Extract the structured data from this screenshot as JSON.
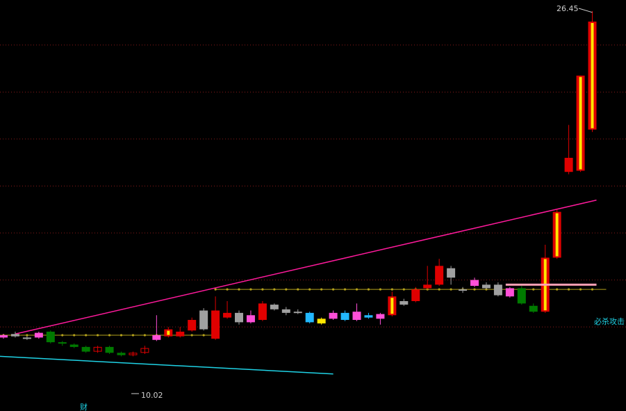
{
  "chart_data": {
    "type": "candlestick",
    "ylim": [
      9.6,
      26.8
    ],
    "grid": true,
    "colors": {
      "background": "#000000",
      "grid": "#8b1a1a",
      "up": "#e00000",
      "down": "#007a00",
      "trend_line": "#ff1a9c",
      "support_line": "#b5a21c",
      "lower_line": "#1fd3e6",
      "signal_line": "#ff9fb5",
      "signal_text": "#1fd3e6",
      "annotation": "#d0d0d0",
      "limit_up_fill": "#ffe600",
      "limit_up_edge": "#e00000"
    },
    "candles": [
      {
        "o": 12.65,
        "c": 12.55,
        "h": 12.7,
        "l": 12.5,
        "color": "#ff4fd8"
      },
      {
        "o": 12.7,
        "c": 12.6,
        "h": 12.8,
        "l": 12.55,
        "color": "#a0a0a0"
      },
      {
        "o": 12.55,
        "c": 12.5,
        "h": 12.6,
        "l": 12.45,
        "color": "#a0a0a0"
      },
      {
        "o": 12.75,
        "c": 12.55,
        "h": 12.8,
        "l": 12.5,
        "color": "#ff4fd8"
      },
      {
        "o": 12.8,
        "c": 12.35,
        "h": 12.85,
        "l": 12.3,
        "color": "#007a00"
      },
      {
        "o": 12.35,
        "c": 12.3,
        "h": 12.4,
        "l": 12.2,
        "color": "#007a00"
      },
      {
        "o": 12.25,
        "c": 12.15,
        "h": 12.3,
        "l": 12.1,
        "color": "#007a00"
      },
      {
        "o": 12.15,
        "c": 11.95,
        "h": 12.2,
        "l": 11.9,
        "color": "#007a00"
      },
      {
        "o": 11.95,
        "c": 12.15,
        "h": 12.2,
        "l": 11.9,
        "color": "#e00000",
        "hollow": true
      },
      {
        "o": 12.15,
        "c": 11.9,
        "h": 12.2,
        "l": 11.85,
        "color": "#007a00"
      },
      {
        "o": 11.9,
        "c": 11.8,
        "h": 11.95,
        "l": 11.75,
        "color": "#007a00"
      },
      {
        "o": 11.8,
        "c": 11.9,
        "h": 11.95,
        "l": 11.75,
        "color": "#e00000",
        "hollow": true
      },
      {
        "o": 11.9,
        "c": 12.1,
        "h": 12.2,
        "l": 11.85,
        "color": "#e00000",
        "hollow": true
      },
      {
        "o": 12.45,
        "c": 12.65,
        "h": 13.5,
        "l": 12.4,
        "color": "#ff4fd8"
      },
      {
        "o": 12.6,
        "c": 12.9,
        "h": 13.0,
        "l": 12.55,
        "color": "#e00000",
        "limit": true
      },
      {
        "o": 12.6,
        "c": 12.8,
        "h": 13.0,
        "l": 12.55,
        "color": "#e00000"
      },
      {
        "o": 12.85,
        "c": 13.3,
        "h": 13.4,
        "l": 12.8,
        "color": "#e00000"
      },
      {
        "o": 12.9,
        "c": 13.7,
        "h": 13.8,
        "l": 12.85,
        "color": "#a0a0a0"
      },
      {
        "o": 12.5,
        "c": 13.7,
        "h": 14.3,
        "l": 12.45,
        "color": "#e00000"
      },
      {
        "o": 13.4,
        "c": 13.6,
        "h": 14.1,
        "l": 13.35,
        "color": "#e00000"
      },
      {
        "o": 13.6,
        "c": 13.2,
        "h": 13.7,
        "l": 13.1,
        "color": "#a0a0a0"
      },
      {
        "o": 13.2,
        "c": 13.5,
        "h": 13.7,
        "l": 13.15,
        "color": "#ff4fd8"
      },
      {
        "o": 13.3,
        "c": 14.0,
        "h": 14.1,
        "l": 13.25,
        "color": "#e00000"
      },
      {
        "o": 13.95,
        "c": 13.75,
        "h": 14.0,
        "l": 13.7,
        "color": "#a0a0a0"
      },
      {
        "o": 13.75,
        "c": 13.6,
        "h": 13.85,
        "l": 13.5,
        "color": "#a0a0a0"
      },
      {
        "o": 13.65,
        "c": 13.6,
        "h": 13.75,
        "l": 13.55,
        "color": "#a0a0a0"
      },
      {
        "o": 13.6,
        "c": 13.2,
        "h": 13.65,
        "l": 13.15,
        "color": "#22b8ff"
      },
      {
        "o": 13.35,
        "c": 13.15,
        "h": 13.4,
        "l": 13.1,
        "color": "#ffe600"
      },
      {
        "o": 13.35,
        "c": 13.6,
        "h": 13.7,
        "l": 13.3,
        "color": "#ff4fd8"
      },
      {
        "o": 13.3,
        "c": 13.6,
        "h": 13.7,
        "l": 13.25,
        "color": "#22b8ff"
      },
      {
        "o": 13.3,
        "c": 13.65,
        "h": 14.0,
        "l": 13.25,
        "color": "#ff4fd8"
      },
      {
        "o": 13.5,
        "c": 13.4,
        "h": 13.6,
        "l": 13.35,
        "color": "#22b8ff"
      },
      {
        "o": 13.35,
        "c": 13.55,
        "h": 13.6,
        "l": 13.1,
        "color": "#ff4fd8"
      },
      {
        "o": 13.5,
        "c": 14.3,
        "h": 14.5,
        "l": 13.45,
        "color": "#e00000",
        "limit": true
      },
      {
        "o": 14.1,
        "c": 13.95,
        "h": 14.2,
        "l": 13.9,
        "color": "#a0a0a0"
      },
      {
        "o": 14.1,
        "c": 14.6,
        "h": 14.7,
        "l": 14.05,
        "color": "#e00000"
      },
      {
        "o": 14.65,
        "c": 14.8,
        "h": 15.6,
        "l": 14.6,
        "color": "#e00000"
      },
      {
        "o": 14.8,
        "c": 15.6,
        "h": 15.9,
        "l": 14.75,
        "color": "#e00000"
      },
      {
        "o": 15.5,
        "c": 15.1,
        "h": 15.6,
        "l": 14.8,
        "color": "#a0a0a0"
      },
      {
        "o": 14.55,
        "c": 14.6,
        "h": 14.7,
        "l": 14.45,
        "color": "#a0a0a0"
      },
      {
        "o": 15.0,
        "c": 14.75,
        "h": 15.1,
        "l": 14.7,
        "color": "#ff4fd8"
      },
      {
        "o": 14.8,
        "c": 14.65,
        "h": 14.9,
        "l": 14.6,
        "color": "#a0a0a0"
      },
      {
        "o": 14.8,
        "c": 14.35,
        "h": 14.9,
        "l": 14.3,
        "color": "#a0a0a0"
      },
      {
        "o": 14.65,
        "c": 14.3,
        "h": 14.7,
        "l": 14.25,
        "color": "#ff4fd8"
      },
      {
        "o": 14.65,
        "c": 14.0,
        "h": 14.75,
        "l": 13.95,
        "color": "#007a00"
      },
      {
        "o": 13.9,
        "c": 13.65,
        "h": 14.0,
        "l": 13.6,
        "color": "#007a00"
      },
      {
        "o": 13.65,
        "c": 15.95,
        "h": 16.5,
        "l": 13.6,
        "color": "#e00000",
        "limit": true
      },
      {
        "o": 15.95,
        "c": 17.9,
        "h": 18.0,
        "l": 15.9,
        "color": "#e00000",
        "limit": true
      },
      {
        "o": 19.6,
        "c": 20.2,
        "h": 21.6,
        "l": 19.5,
        "color": "#e00000"
      },
      {
        "o": 19.65,
        "c": 23.7,
        "h": 23.7,
        "l": 19.6,
        "color": "#e00000",
        "limit": true
      },
      {
        "o": 21.4,
        "c": 26.0,
        "h": 26.45,
        "l": 21.3,
        "color": "#e00000",
        "limit": true
      }
    ],
    "support_level": 14.6,
    "support_left_level": 12.65,
    "trend_line": {
      "from": 12.7,
      "to": 18.4
    },
    "lower_line": {
      "from": 11.75,
      "to": 11.0
    },
    "signal_line_level": 14.8,
    "annotations": {
      "high": "26.45",
      "low": "10.02",
      "signal": "必杀攻击",
      "bottom_char": "财"
    }
  }
}
